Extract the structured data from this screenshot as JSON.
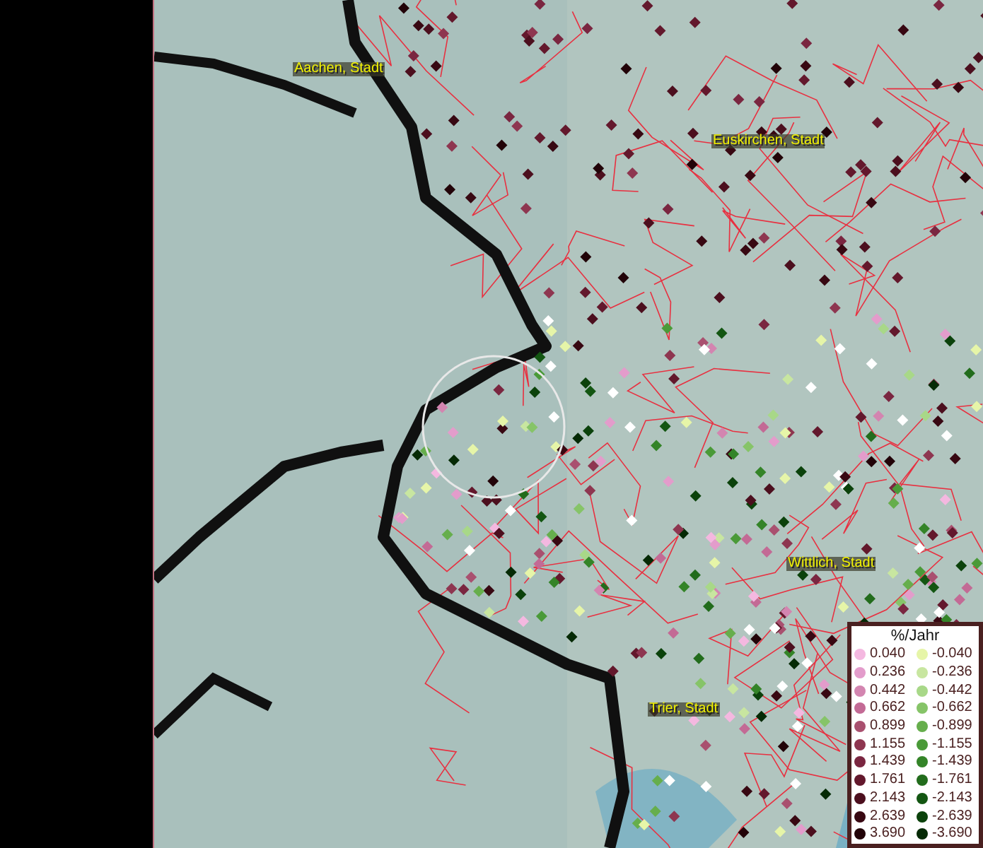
{
  "map": {
    "places": [
      {
        "name": "Aachen, Stadt"
      },
      {
        "name": "Euskirchen, Stadt"
      },
      {
        "name": "Wittlich, Stadt"
      },
      {
        "name": "Trier, Stadt"
      }
    ]
  },
  "legend": {
    "title": "%/Jahr",
    "entries": [
      {
        "label": "0.040",
        "color": "#f4b8e0"
      },
      {
        "label": "-0.040",
        "color": "#e6f5a8"
      },
      {
        "label": "0.236",
        "color": "#e39ccb"
      },
      {
        "label": "-0.236",
        "color": "#c8e6a0"
      },
      {
        "label": "0.442",
        "color": "#d385b0"
      },
      {
        "label": "-0.442",
        "color": "#a8d888"
      },
      {
        "label": "0.662",
        "color": "#c36a95"
      },
      {
        "label": "-0.662",
        "color": "#86c468"
      },
      {
        "label": "0.899",
        "color": "#a9506f"
      },
      {
        "label": "-0.899",
        "color": "#66ae4c"
      },
      {
        "label": "1.155",
        "color": "#8e3650"
      },
      {
        "label": "-1.155",
        "color": "#4a9a38"
      },
      {
        "label": "1.439",
        "color": "#7a2640"
      },
      {
        "label": "-1.439",
        "color": "#348428"
      },
      {
        "label": "1.761",
        "color": "#63182c"
      },
      {
        "label": "-1.761",
        "color": "#226c1c"
      },
      {
        "label": "2.143",
        "color": "#4c0f1e"
      },
      {
        "label": "-2.143",
        "color": "#135612"
      },
      {
        "label": "2.639",
        "color": "#380812"
      },
      {
        "label": "-2.639",
        "color": "#0b420b"
      },
      {
        "label": "3.690",
        "color": "#220308"
      },
      {
        "label": "-3.690",
        "color": "#052a05"
      }
    ]
  }
}
